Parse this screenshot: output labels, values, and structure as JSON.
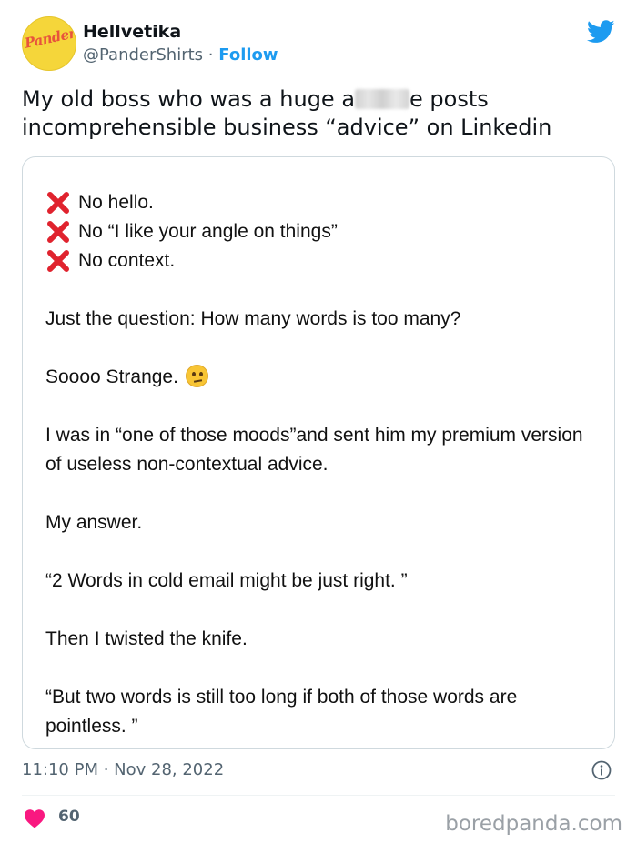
{
  "author": {
    "display_name": "Hellvetika",
    "handle": "@PanderShirts",
    "separator": "·",
    "follow_label": "Follow",
    "avatar_text": "Pander"
  },
  "tweet": {
    "text_before": "My old boss who was a huge a",
    "text_after": "e posts incomprehensible business “advice” on Linkedin"
  },
  "image_post": {
    "x_lines": [
      "No hello.",
      "No “I like your angle on things”",
      "No context."
    ],
    "question": "Just the question: How many words is too many?",
    "strange": "Soooo Strange.",
    "mood": "I was in “one of those moods”and sent him my premium version of useless non-contextual advice.",
    "my_answer": "My answer.",
    "answer_quote": "“2 Words in cold email might be just right. ”",
    "twist": "Then I twisted the knife.",
    "final_quote": "“But two words is still too long if both of those words are pointless. ”"
  },
  "meta": {
    "timestamp": "11:10 PM · Nov 28, 2022",
    "like_count": "60",
    "watermark": "boredpanda.com"
  },
  "icons": {
    "brand": "twitter-bird-icon",
    "x_mark": "red-x-icon",
    "emoji": "thinking-face-emoji",
    "info": "info-icon",
    "like": "heart-icon"
  },
  "colors": {
    "accent": "#1d9bf0",
    "heart": "#f91880",
    "x_mark": "#e0232e",
    "secondary_text": "#536471"
  }
}
